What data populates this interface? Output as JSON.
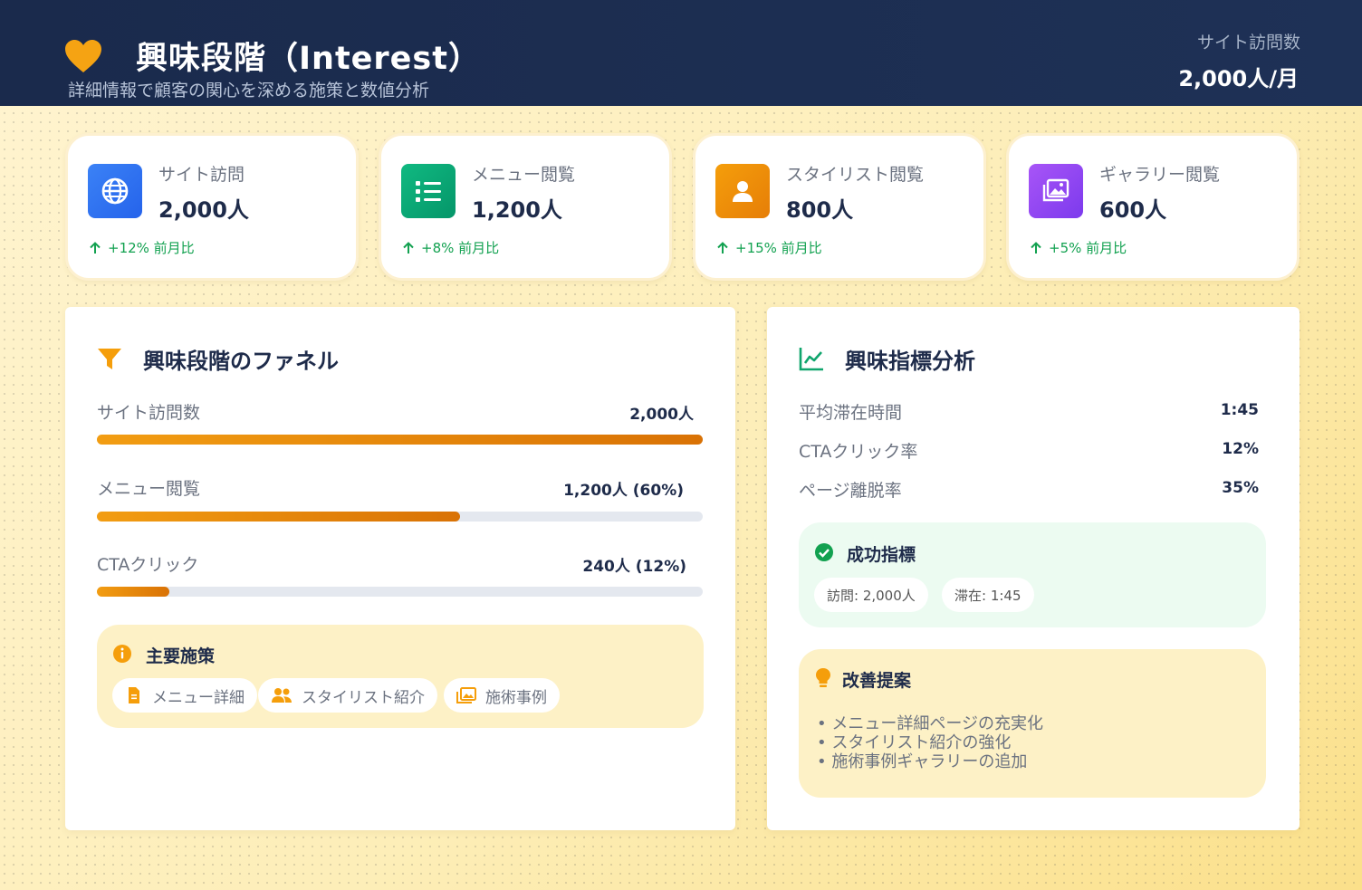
{
  "header": {
    "title": "興味段階（Interest）",
    "subtitle": "詳細情報で顧客の関心を深める施策と数値分析",
    "stat_label": "サイト訪問数",
    "stat_value": "2,000人/月",
    "accent": "#f5a313"
  },
  "stats": [
    {
      "label": "サイト訪問",
      "value": "2,000人",
      "trend": "+12% 前月比",
      "icon": "globe-icon",
      "color": "#2f6fe4"
    },
    {
      "label": "メニュー閲覧",
      "value": "1,200人",
      "trend": "+8% 前月比",
      "icon": "list-icon",
      "color": "#10a56d"
    },
    {
      "label": "スタイリスト閲覧",
      "value": "800人",
      "trend": "+15% 前月比",
      "icon": "person-icon",
      "color": "#ee8c0c"
    },
    {
      "label": "ギャラリー閲覧",
      "value": "600人",
      "trend": "+5% 前月比",
      "icon": "gallery-icon",
      "color": "#8b47ec"
    }
  ],
  "funnel": {
    "title": "興味段階のファネル",
    "rows": [
      {
        "label": "サイト訪問数",
        "value": "2,000人",
        "fraction": 1.0
      },
      {
        "label": "メニュー閲覧",
        "value": "1,200人 (60%)",
        "fraction": 0.6
      },
      {
        "label": "CTAクリック",
        "value": "240人 (12%)",
        "fraction": 0.12
      }
    ],
    "measures_title": "主要施策",
    "measures": [
      {
        "label": "メニュー詳細",
        "icon": "document-icon"
      },
      {
        "label": "スタイリスト紹介",
        "icon": "users-icon"
      },
      {
        "label": "施術事例",
        "icon": "images-icon"
      }
    ]
  },
  "metrics": {
    "title": "興味指標分析",
    "rows": [
      {
        "label": "平均滞在時間",
        "value": "1:45"
      },
      {
        "label": "CTAクリック率",
        "value": "12%"
      },
      {
        "label": "ページ離脱率",
        "value": "35%"
      }
    ],
    "success_title": "成功指標",
    "success_tags": [
      "訪問: 2,000人",
      "滞在: 1:45"
    ],
    "improve_title": "改善提案",
    "improvements": [
      "• メニュー詳細ページの充実化",
      "• スタイリスト紹介の強化",
      "• 施術事例ギャラリーの追加"
    ]
  }
}
